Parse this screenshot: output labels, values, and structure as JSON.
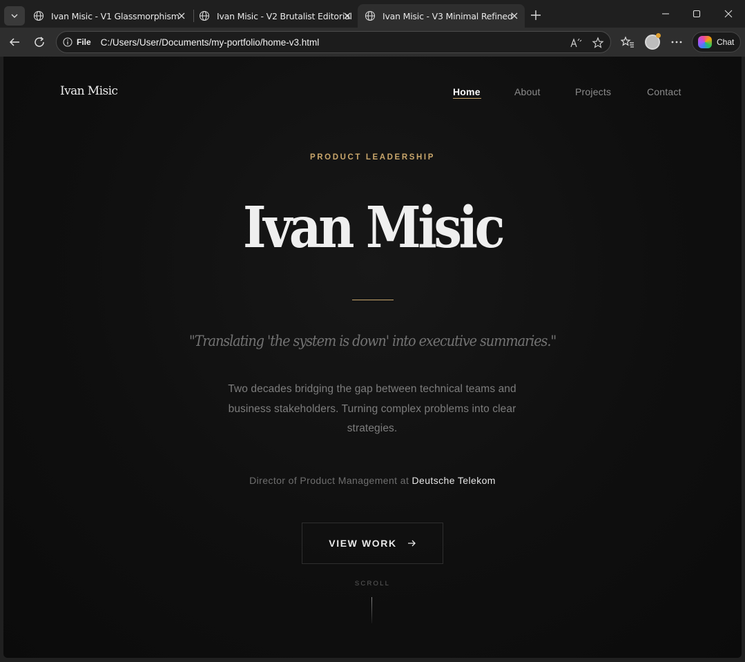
{
  "browser": {
    "tabs": [
      {
        "title": "Ivan Misic - V1 Glassmorphism"
      },
      {
        "title": "Ivan Misic - V2 Brutalist Editorial"
      },
      {
        "title": "Ivan Misic - V3 Minimal Refined"
      }
    ],
    "active_tab": 2,
    "address": {
      "scheme_label": "File",
      "url": "C:/Users/User/Documents/my-portfolio/home-v3.html"
    },
    "chat_label": "Chat",
    "icons": [
      "tab-list-icon",
      "globe-icon",
      "close-icon",
      "new-tab-icon",
      "minimize-icon",
      "maximize-icon",
      "window-close-icon",
      "back-icon",
      "reload-icon",
      "info-icon",
      "read-aloud-icon",
      "favorite-star-icon",
      "favorites-icon",
      "profile-avatar",
      "more-icon",
      "copilot-icon"
    ]
  },
  "site": {
    "logo": "Ivan Misic",
    "nav": [
      {
        "label": "Home",
        "active": true
      },
      {
        "label": "About",
        "active": false
      },
      {
        "label": "Projects",
        "active": false
      },
      {
        "label": "Contact",
        "active": false
      }
    ],
    "hero": {
      "eyebrow": "PRODUCT LEADERSHIP",
      "name": "Ivan Misic",
      "quote": "\"Translating 'the system is down' into executive summaries.\"",
      "bio": "Two decades bridging the gap between technical teams and business stakeholders. Turning complex problems into clear strategies.",
      "role_prefix": "Director of Product Management at ",
      "company": "Deutsche Telekom",
      "cta_label": "VIEW WORK",
      "scroll_label": "SCROLL"
    },
    "colors": {
      "accent": "#c9a66b",
      "background": "#0f0f0f",
      "text": "#efefef"
    }
  }
}
